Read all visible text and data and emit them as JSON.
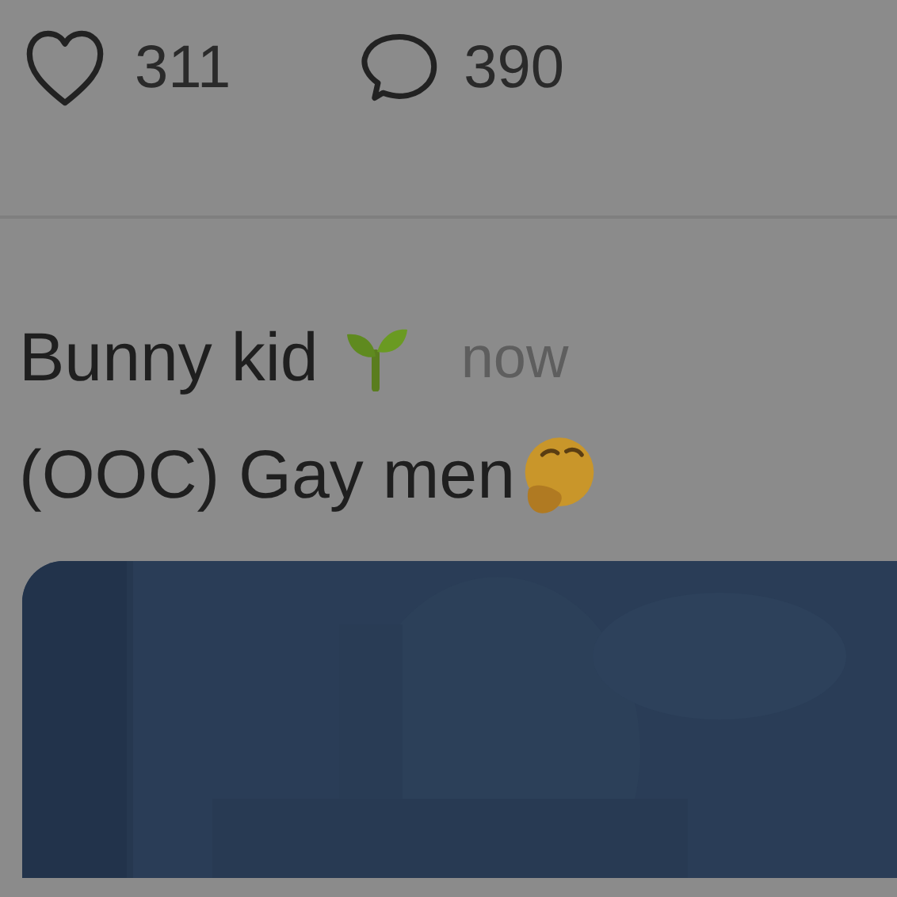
{
  "post_stats": {
    "likes": "311",
    "comments": "390"
  },
  "next_post": {
    "author": "Bunny kid",
    "time": "now",
    "text": "(OOC) Gay men"
  }
}
